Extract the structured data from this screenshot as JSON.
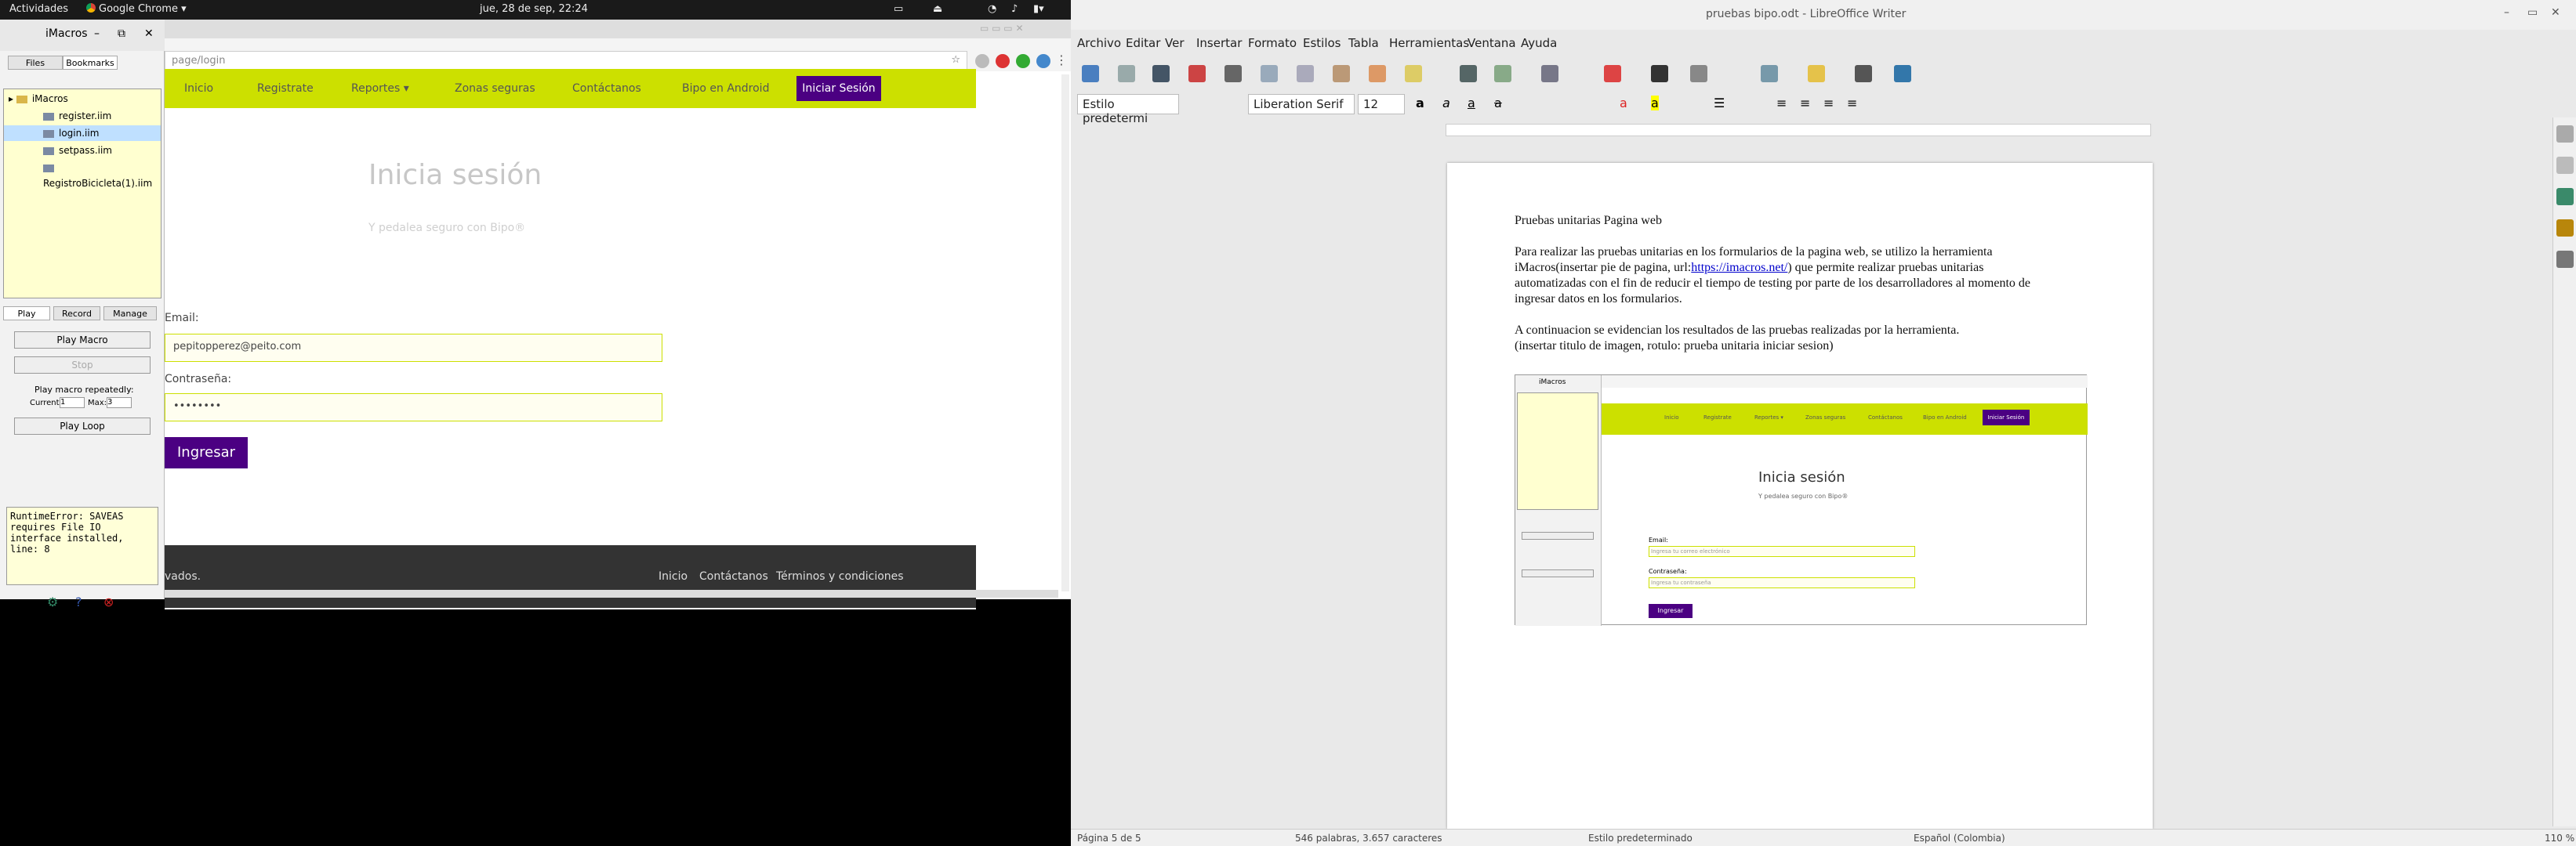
{
  "topbar": {
    "activities": "Actividades",
    "app_menu": "Google Chrome",
    "clock": "jue, 28 de sep, 22:24"
  },
  "imacros": {
    "title": "iMacros",
    "tabs": [
      "Files",
      "Bookmarks"
    ],
    "tree_root": "iMacros",
    "files": [
      "register.iim",
      "login.iim",
      "setpass.iim",
      "RegistroBicicleta(1).iim"
    ],
    "selected_index": 1,
    "mode_tabs": [
      "Play",
      "Record",
      "Manage"
    ],
    "play_macro": "Play Macro",
    "stop": "Stop",
    "repeat_label": "Play macro repeatedly:",
    "current_label": "Current:",
    "max_label": "Max:",
    "current_value": "1",
    "max_value": "3",
    "play_loop": "Play Loop",
    "error_text": "RuntimeError: SAVEAS requires File IO interface installed, line: 8"
  },
  "chrome": {
    "url": "page/login",
    "nav": {
      "inicio": "Inicio",
      "registrate": "Registrate",
      "reportes": "Reportes ▾",
      "zonas": "Zonas seguras",
      "contactanos": "Contáctanos",
      "bipo_android": "Bipo en Android",
      "iniciar": "Iniciar Sesión"
    },
    "hero_title": "Inicia sesión",
    "hero_sub": "Y pedalea seguro con Bipo®",
    "email_label": "Email:",
    "email_value": "pepitopperez@peito.com",
    "password_label": "Contraseña:",
    "password_value": "••••••••",
    "submit": "Ingresar",
    "footer_left": "vados.",
    "footer_links": [
      "Inicio",
      "Contáctanos",
      "Términos y condiciones"
    ]
  },
  "lo": {
    "title": "pruebas bipo.odt - LibreOffice Writer",
    "menu": [
      "Archivo",
      "Editar",
      "Ver",
      "Insertar",
      "Formato",
      "Estilos",
      "Tabla",
      "Herramientas",
      "Ventana",
      "Ayuda"
    ],
    "style_combo": "Estilo predetermi",
    "font_combo": "Liberation Serif",
    "size_combo": "12",
    "doc": {
      "heading": "Pruebas unitarias Pagina web",
      "para1_line1": "Para realizar las pruebas unitarias en los formularios de la pagina web, se utilizo la herramienta",
      "para1_line2_a": "iMacros(insertar pie de pagina, url:",
      "para1_link": "https://imacros.net/",
      "para1_line2_b": ") que permite realizar pruebas unitarias",
      "para1_line3": "automatizadas con el fin de reducir el tiempo de testing por parte de los desarrolladores al momento de",
      "para1_line4": "ingresar datos en los formularios.",
      "para2_line1": "A continuacion se evidencian los resultados de las pruebas realizadas por la herramienta.",
      "para2_line2": "(insertar titulo de imagen, rotulo: prueba unitaria iniciar sesion)"
    },
    "embed": {
      "title": "iMacros",
      "nav": [
        "Inicio",
        "Registrate",
        "Reportes ▾",
        "Zonas seguras",
        "Contáctanos",
        "Bipo en Android",
        "Iniciar Sesión"
      ],
      "hero_title": "Inicia sesión",
      "hero_sub": "Y pedalea seguro con Bipo®",
      "email_label": "Email:",
      "email_ph": "Ingresa tu correo electrónico",
      "pass_label": "Contraseña:",
      "pass_ph": "Ingresa tu contraseña",
      "submit": "Ingresar"
    },
    "status": {
      "page": "Página 5 de 5",
      "words": "546 palabras, 3.657 caracteres",
      "style": "Estilo predeterminado",
      "lang": "Español (Colombia)",
      "zoom": "110 %"
    }
  }
}
